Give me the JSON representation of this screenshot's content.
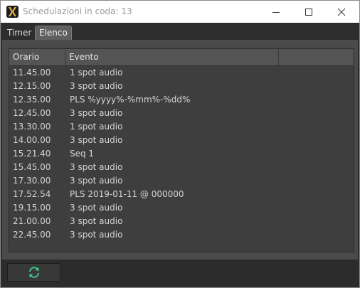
{
  "window": {
    "title": "Schedulazioni in coda: 13",
    "icon": "app-logo-icon",
    "controls": [
      "minimize-icon",
      "maximize-icon",
      "close-icon"
    ]
  },
  "tabs": [
    {
      "label": "Timer",
      "active": false
    },
    {
      "label": "Elenco",
      "active": true
    }
  ],
  "list": {
    "columns": [
      "Orario",
      "Evento",
      ""
    ],
    "rows": [
      {
        "orario": "11.45.00",
        "evento": "1 spot audio"
      },
      {
        "orario": "12.15.00",
        "evento": "3 spot audio"
      },
      {
        "orario": "12.35.00",
        "evento": "PLS %yyyy%-%mm%-%dd%"
      },
      {
        "orario": "12.45.00",
        "evento": "3 spot audio"
      },
      {
        "orario": "13.30.00",
        "evento": "1 spot audio"
      },
      {
        "orario": "14.00.00",
        "evento": "3 spot audio"
      },
      {
        "orario": "15.21.40",
        "evento": "Seq 1"
      },
      {
        "orario": "15.45.00",
        "evento": "3 spot audio"
      },
      {
        "orario": "17.30.00",
        "evento": "3 spot audio"
      },
      {
        "orario": "17.52.54",
        "evento": "PLS 2019-01-11 @ 000000"
      },
      {
        "orario": "19.15.00",
        "evento": "3 spot audio"
      },
      {
        "orario": "21.00.00",
        "evento": "3 spot audio"
      },
      {
        "orario": "22.45.00",
        "evento": "3 spot audio"
      }
    ]
  },
  "refresh_button": {
    "icon": "refresh-icon",
    "color": "#3cc489"
  }
}
